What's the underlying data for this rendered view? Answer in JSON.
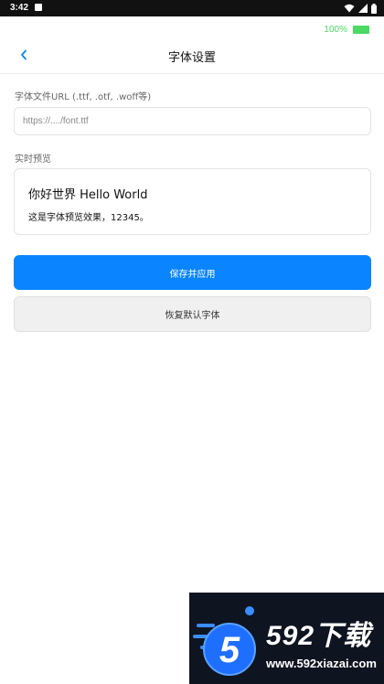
{
  "status_bar": {
    "time": "3:42",
    "icons": [
      "notification-icon",
      "wifi-icon",
      "signal-icon",
      "battery-icon"
    ]
  },
  "battery": {
    "text": "100%",
    "color": "#4cd964"
  },
  "header": {
    "back_icon": "chevron-left-icon",
    "title": "字体设置"
  },
  "font_url": {
    "label": "字体文件URL (.ttf, .otf, .woff等)",
    "value": "",
    "placeholder": "https://..../font.ttf"
  },
  "preview": {
    "label": "实时预览",
    "line1": "你好世界 Hello World",
    "line2": "这是字体预览效果，12345。"
  },
  "buttons": {
    "save_label": "保存并应用",
    "reset_label": "恢复默认字体"
  },
  "colors": {
    "accent": "#0a84ff",
    "secondary_button_bg": "#f0f0f0"
  },
  "watermark": {
    "brand": "592下载",
    "url": "www.592xiazai.com",
    "logo_digit": "5"
  }
}
